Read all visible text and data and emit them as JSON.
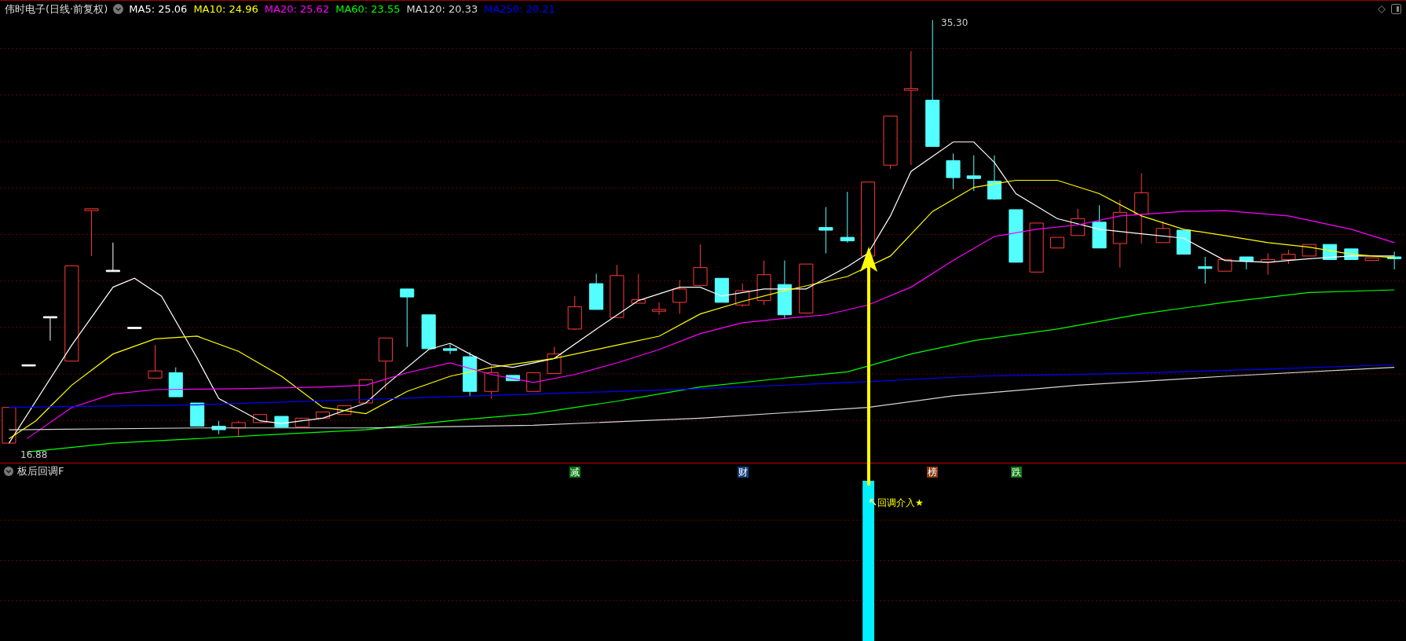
{
  "header": {
    "title": "伟时电子(日线·前复权)",
    "moving_averages": [
      {
        "label": "MA5: 25.06",
        "color": "#ffffff"
      },
      {
        "label": "MA10: 24.96",
        "color": "#ffff00"
      },
      {
        "label": "MA20: 25.62",
        "color": "#ff00ff"
      },
      {
        "label": "MA60: 23.55",
        "color": "#00ff00"
      },
      {
        "label": "MA120: 20.33",
        "color": "#d8d8d8"
      },
      {
        "label": "MA250: 20.21",
        "color": "#0000ff"
      }
    ]
  },
  "main_chart": {
    "high_label": "35.30",
    "low_label": "16.88",
    "tags": [
      {
        "text": "减",
        "color": "#0b7a12"
      },
      {
        "text": "财",
        "color": "#183f7e"
      },
      {
        "text": "榜",
        "color": "#8a3a10"
      },
      {
        "text": "跌",
        "color": "#0b7a12"
      }
    ]
  },
  "indicator_panel": {
    "title": "板后回调F",
    "signal_label": "回调介入★"
  }
}
